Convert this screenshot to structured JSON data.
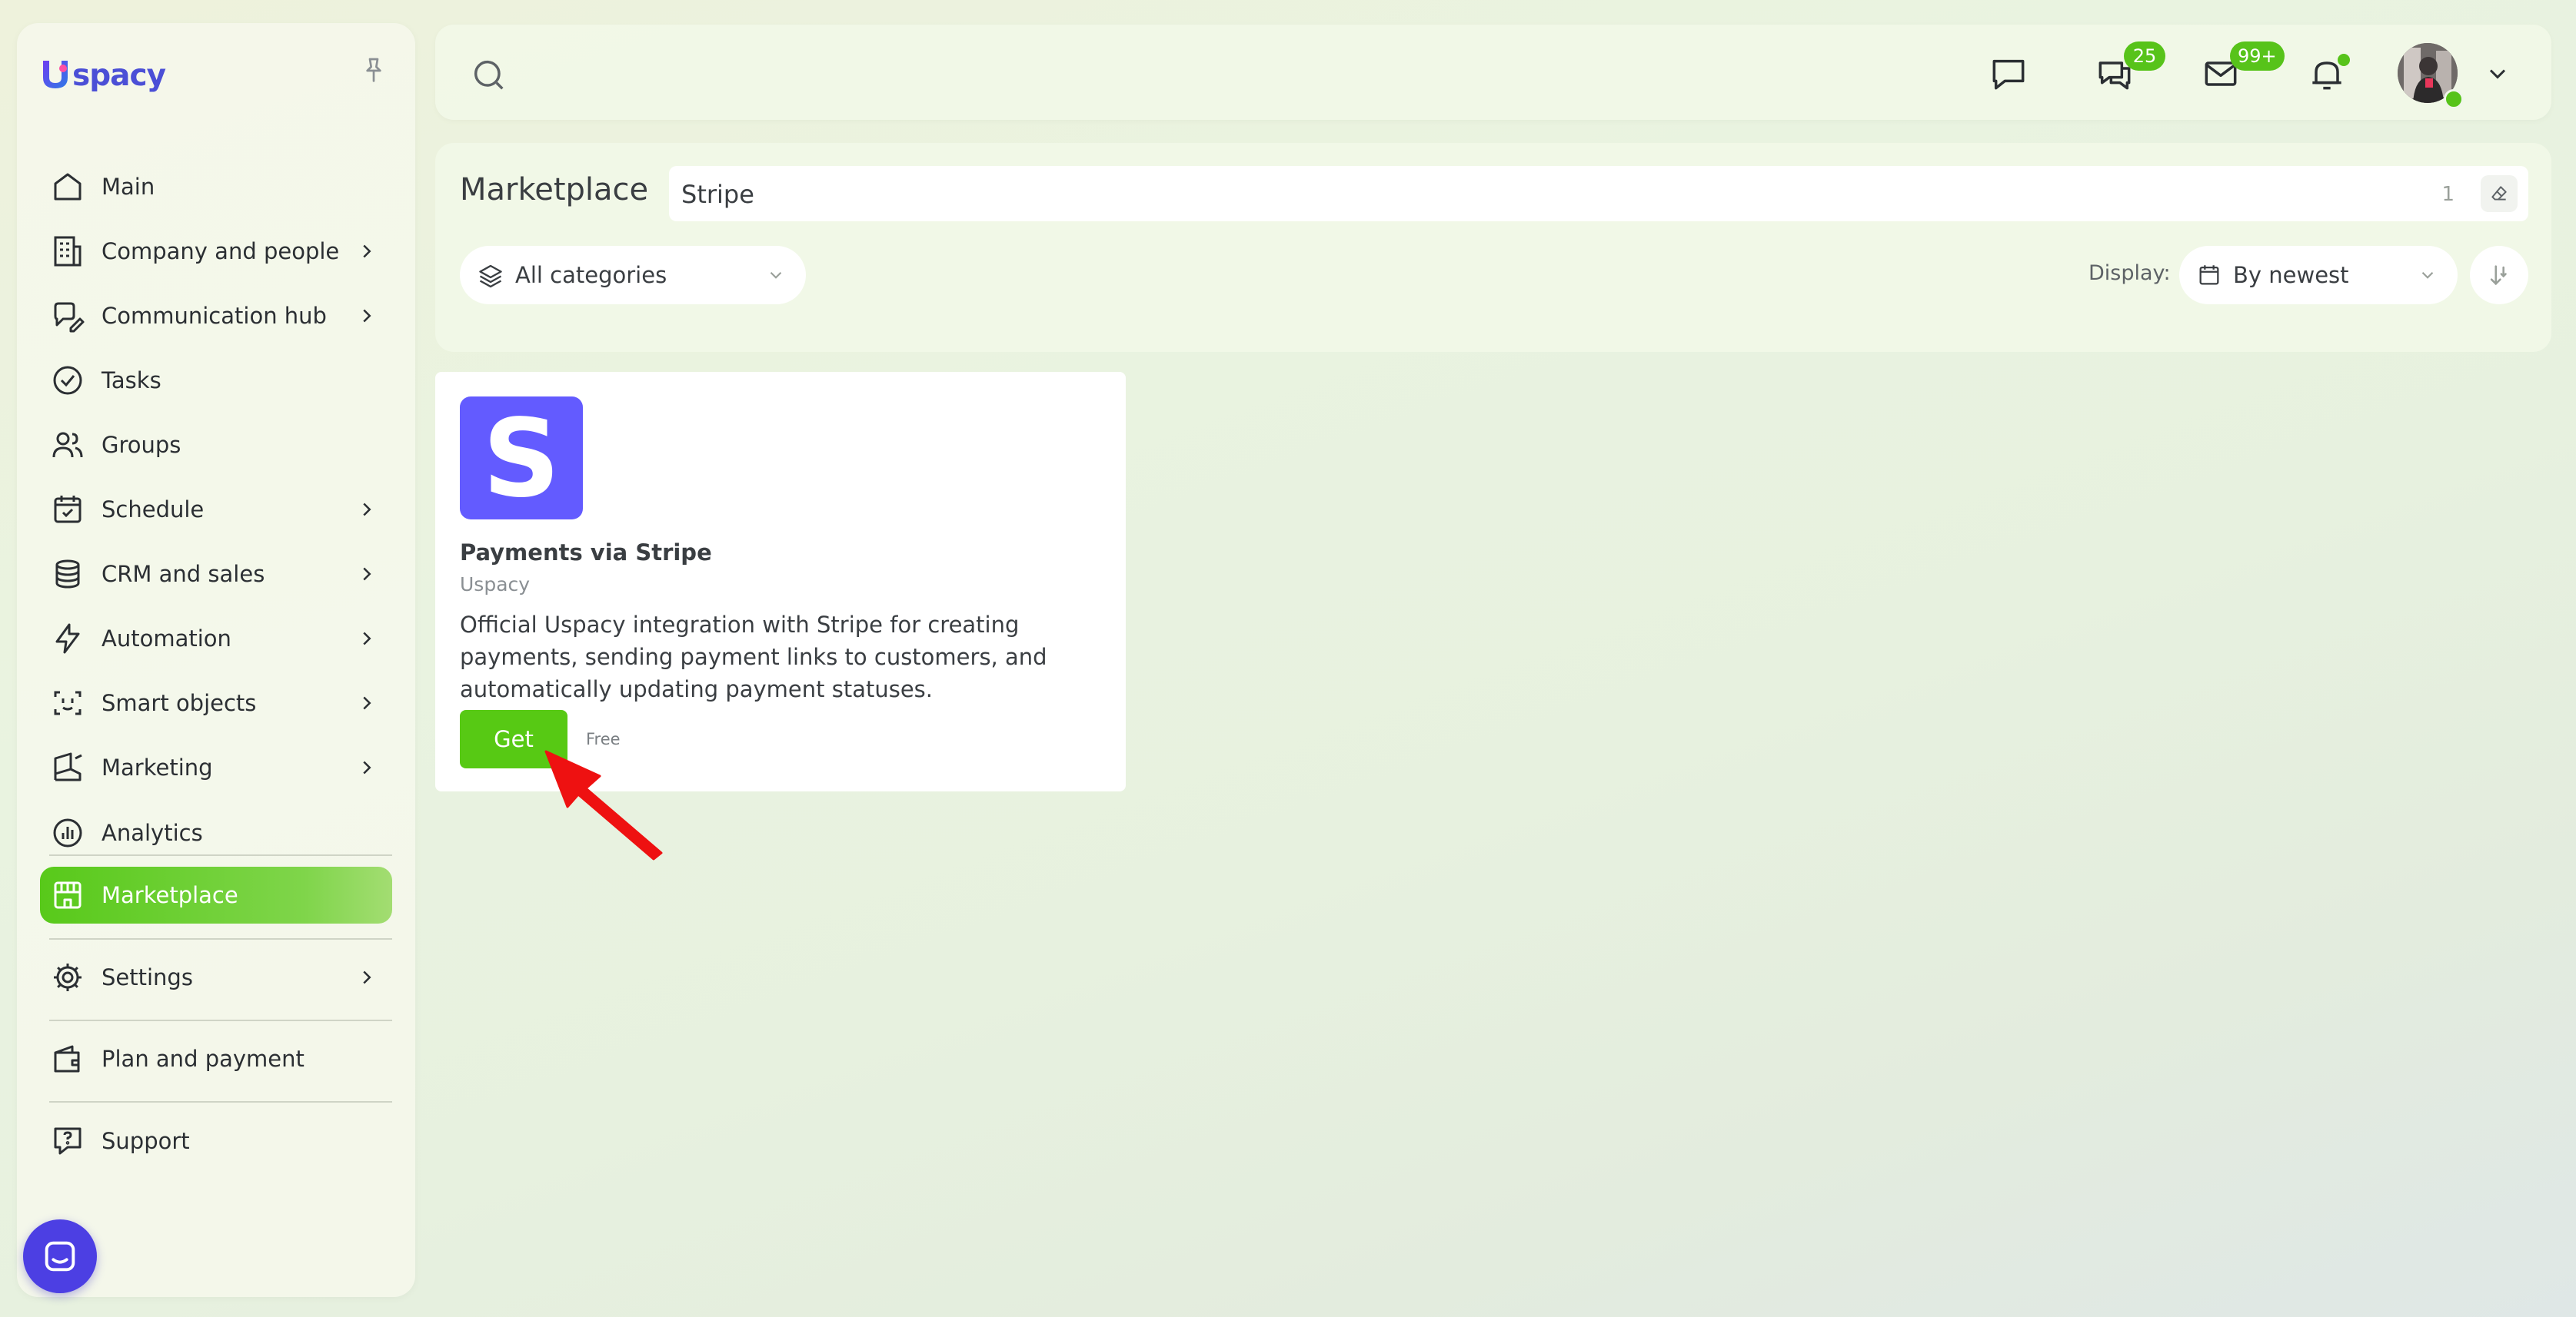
{
  "brand": {
    "logo_text": "spacy",
    "accent_color": "#57c31a",
    "logo_color": "#4b4fd6"
  },
  "sidebar": {
    "items": [
      {
        "label": "Main",
        "icon": "home-icon",
        "has_submenu": false
      },
      {
        "label": "Company and people",
        "icon": "building-icon",
        "has_submenu": true
      },
      {
        "label": "Communication hub",
        "icon": "chat-edit-icon",
        "has_submenu": true
      },
      {
        "label": "Tasks",
        "icon": "check-circle-icon",
        "has_submenu": false
      },
      {
        "label": "Groups",
        "icon": "users-icon",
        "has_submenu": false
      },
      {
        "label": "Schedule",
        "icon": "calendar-check-icon",
        "has_submenu": true
      },
      {
        "label": "CRM and sales",
        "icon": "coins-icon",
        "has_submenu": true
      },
      {
        "label": "Automation",
        "icon": "lightning-icon",
        "has_submenu": true
      },
      {
        "label": "Smart objects",
        "icon": "scan-face-icon",
        "has_submenu": true
      },
      {
        "label": "Marketing",
        "icon": "megaphone-icon",
        "has_submenu": true
      },
      {
        "label": "Analytics",
        "icon": "chart-pie-icon",
        "has_submenu": false
      },
      {
        "label": "Marketplace",
        "icon": "store-icon",
        "has_submenu": false,
        "active": true
      },
      {
        "label": "Settings",
        "icon": "gear-icon",
        "has_submenu": true
      },
      {
        "label": "Plan and payment",
        "icon": "wallet-icon",
        "has_submenu": false
      },
      {
        "label": "Support",
        "icon": "help-icon",
        "has_submenu": false
      }
    ]
  },
  "topbar": {
    "search_placeholder": "",
    "chat_badge": "25",
    "mail_badge": "99+",
    "bell_has_dot": true
  },
  "marketplace": {
    "title": "Marketplace",
    "filter_value": "Stripe",
    "result_count": "1",
    "category_select": "All categories",
    "display_label": "Display:",
    "sort_select": "By newest"
  },
  "app_card": {
    "logo_letter": "S",
    "logo_color": "#635bff",
    "name": "Payments via Stripe",
    "vendor": "Uspacy",
    "description": "Official Uspacy integration with Stripe for creating payments, sending payment links to customers, and automatically updating payment statuses.",
    "button_label": "Get",
    "price": "Free"
  }
}
